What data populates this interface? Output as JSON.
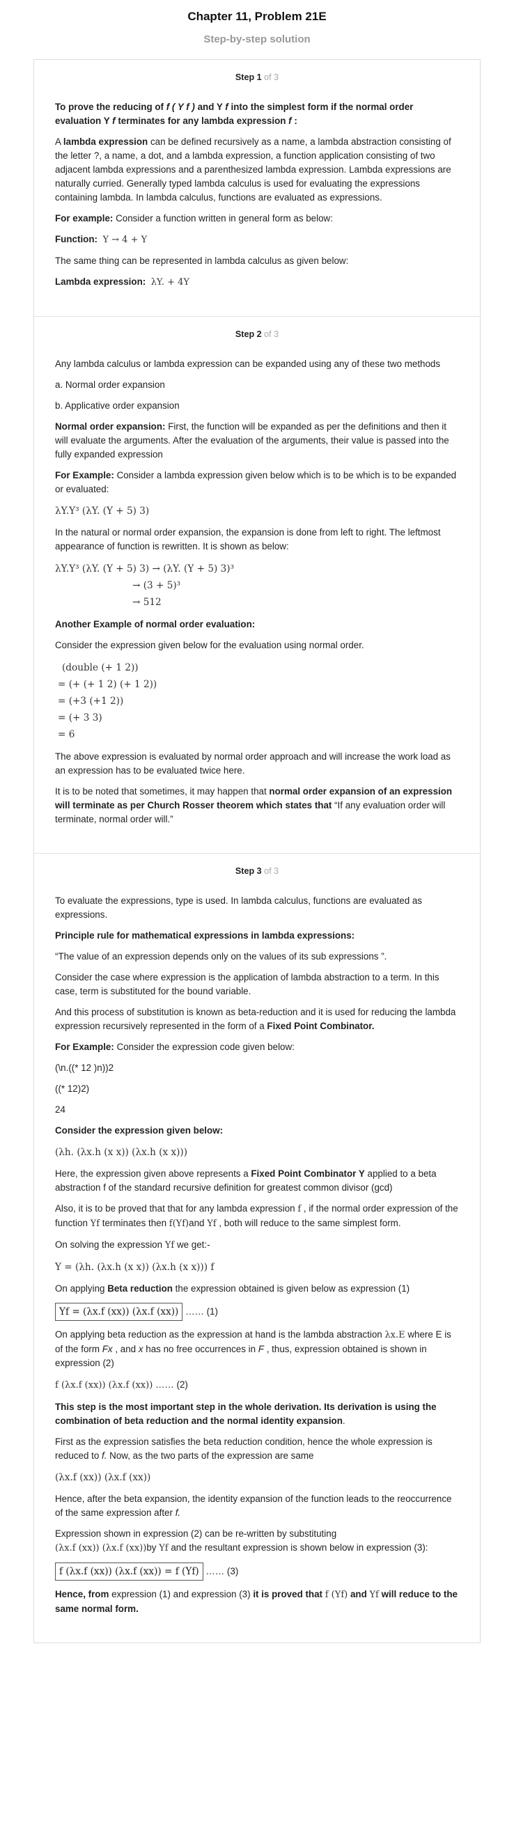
{
  "header": {
    "chapter": "Chapter 11, Problem 21E",
    "subtitle": "Step-by-step solution"
  },
  "step1": {
    "label": "Step 1",
    "of": " of 3",
    "heading_a": "To prove the reducing of ",
    "heading_b": "f ( Y f )",
    "heading_c": " and Y ",
    "heading_d": "f",
    "heading_e": " into the simplest form if the normal order evaluation Y ",
    "heading_f": "f",
    "heading_g": " terminates for any lambda expression ",
    "heading_h": "f",
    "heading_i": " :",
    "p1_a": "A ",
    "p1_b": "lambda expression",
    "p1_c": " can be defined recursively as a name, a lambda abstraction consisting of the letter ?, a name, a dot, and a lambda expression, a function application consisting of two adjacent lambda expressions and a parenthesized lambda expression. Lambda expressions are naturally curried. Generally typed lambda calculus is used for evaluating the expressions containing lambda. In lambda calculus, functions are evaluated as expressions.",
    "example_label": "For example:",
    "example_text": " Consider a function written in general form as below:",
    "function_label": "Function:",
    "function_expr": "Y → 4 + Y",
    "same_text": "The same thing can be represented in lambda calculus as given below:",
    "lambda_label": "Lambda expression:",
    "lambda_expr": "λY. + 4Y"
  },
  "step2": {
    "label": "Step 2",
    "of": " of 3",
    "p1": "Any lambda calculus or lambda expression can be expanded using any of these two methods",
    "a": "a. Normal order expansion",
    "b": "b. Applicative order expansion",
    "normal_label": "Normal order expansion:",
    "normal_text": " First, the function will be expanded as per the definitions and then it will evaluate the arguments. After the evaluation of the arguments, their value is passed into the fully expanded expression",
    "example_label": "For Example:",
    "example_text": " Consider a lambda expression given below which is to be which is to be expanded or evaluated:",
    "expr1": "λY.Y³ (λY. (Y + 5) 3)",
    "p2": "In the natural or normal order expansion, the expansion is done from left to right. The leftmost appearance of function is rewritten. It is shown as below:",
    "chain1": "λY.Y³ (λY. (Y + 5) 3) → (λY. (Y + 5) 3)³",
    "chain2": "→ (3 + 5)³",
    "chain3": "→ 512",
    "another_label": "Another Example of normal order evaluation:",
    "p3": "Consider the expression given below for the evaluation using normal order.",
    "e1": "(double (+ 1 2))",
    "e2": "= (+ (+ 1 2) (+ 1 2))",
    "e3": "= (+3 (+1 2))",
    "e4": "= (+ 3 3)",
    "e5": "= 6",
    "p4": "The above expression is evaluated by normal order approach and will increase the work load as an expression has to be evaluated twice here.",
    "p5_a": "It is to be noted that sometimes, it may happen that ",
    "p5_b": "normal order expansion of an expression will terminate as per Church Rosser theorem which states that",
    "p5_c": " “If any evaluation order will terminate, normal order will.”"
  },
  "step3": {
    "label": "Step 3",
    "of": " of 3",
    "p1": "To evaluate the expressions, type is used. In lambda calculus, functions are evaluated as expressions.",
    "principle": "Principle rule for mathematical expressions in lambda expressions:",
    "quote": "“The value of an expression depends only on the values of its sub expressions ”.",
    "p2": "Consider the case where expression is the application of lambda abstraction to a term. In this case, term is substituted for the bound variable.",
    "p3_a": "And this process of substitution is known as beta-reduction and it is used for reducing the lambda expression recursively represented in the form of a ",
    "p3_b": "Fixed Point Combinator.",
    "example_label": "For Example:",
    "example_text": " Consider the expression code given below:",
    "code1": "(\\n.((* 12 )n))2",
    "code2": "((* 12)2)",
    "code3": "24",
    "consider": "Consider the expression given below:",
    "yexpr": "(λh. (λx.h (x x)) (λx.h (x x)))",
    "p4_a": "Here, the expression given above represents a ",
    "p4_b": "Fixed Point Combinator Y",
    "p4_c": " applied to a beta abstraction f of the standard recursive definition for greatest common divisor (gcd)",
    "p5_a": "Also, it is to be proved that that for any lambda expression ",
    "p5_f": "f",
    "p5_b": " , if the normal order expression of the function ",
    "p5_yf": "Yf",
    "p5_c": " terminates then ",
    "p5_fyf": "f(Yf)",
    "p5_d": "and ",
    "p5_yf2": "Yf",
    "p5_e": " , both will reduce to the same simplest form.",
    "solving_a": "On solving the expression ",
    "solving_yf": "Yf",
    "solving_b": " we get:-",
    "yeq": "Y = (λh. (λx.h (x x)) (λx.h (x x))) f",
    "beta_a": "On applying ",
    "beta_b": "Beta reduction",
    "beta_c": " the expression obtained is given below as expression (1)",
    "eq1": "Yf = (λx.f (xx)) (λx.f (xx))",
    "eq1_tag": " …… (1)",
    "p6_a": "On applying beta reduction as the expression at hand is the lambda abstraction ",
    "p6_lx": "λx.E",
    "p6_b": " where E is of the form ",
    "p6_fx": "Fx",
    "p6_c": " , and ",
    "p6_x": "x",
    "p6_d": " has no free occurrences in ",
    "p6_F": "F",
    "p6_e": " , thus, expression obtained is shown in expression (2)",
    "eq2": "f (λx.f (xx)) (λx.f (xx))",
    "eq2_tag": " …… (2)",
    "important": "This step is the most important step in the whole derivation. Its derivation is using the combination of beta reduction and the normal identity expansion",
    "important_end": ".",
    "p7_a": "First as the expression satisfies the beta reduction condition, hence the whole expression is reduced to ",
    "p7_f": "f.",
    "p7_b": " Now, as the two parts of the expression are same",
    "eq_same": "(λx.f (xx)) (λx.f (xx))",
    "p8_a": "Hence, after the beta expansion, the identity expansion of the function leads to the reoccurrence of the same expression after ",
    "p8_f": "f.",
    "p9_a": "Expression shown in expression (2) can be re-written by substituting",
    "p9_expr": "(λx.f (xx)) (λx.f (xx))",
    "p9_by": "by ",
    "p9_yf": "Yf",
    "p9_b": " and the resultant expression is shown below in expression (3):",
    "eq3": "f (λx.f (xx)) (λx.f (xx)) = f (Yf)",
    "eq3_tag": " …… (3)",
    "final_a": "Hence, from",
    "final_b": " expression (1) and expression (3) ",
    "final_c": "it is proved that ",
    "final_fyf": "f (Yf)",
    "final_d": " and ",
    "final_yf": "Yf",
    "final_e": " will reduce to the same normal form."
  }
}
